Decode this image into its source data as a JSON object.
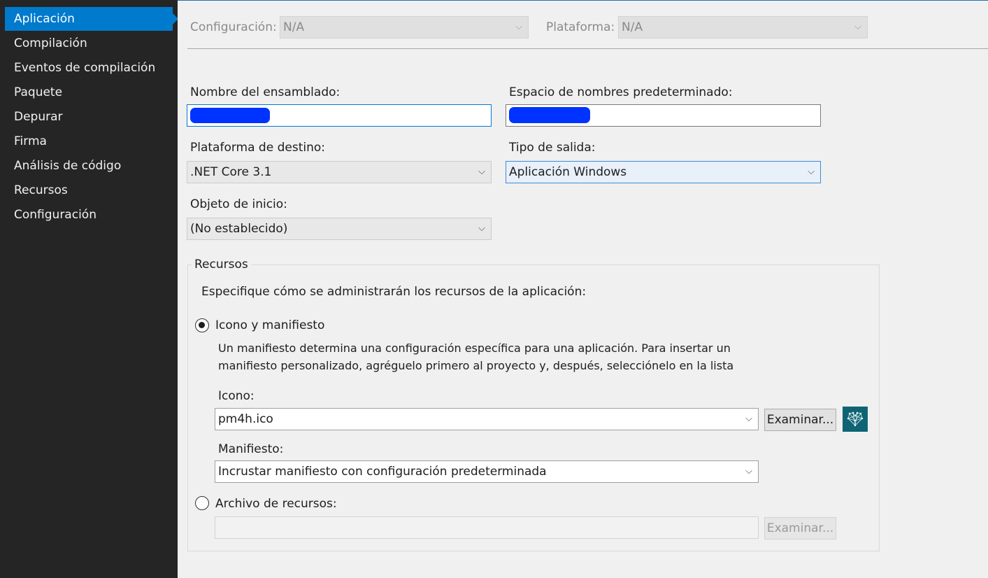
{
  "sidebar": {
    "items": [
      {
        "label": "Aplicación",
        "active": true
      },
      {
        "label": "Compilación"
      },
      {
        "label": "Eventos de compilación"
      },
      {
        "label": "Paquete"
      },
      {
        "label": "Depurar"
      },
      {
        "label": "Firma"
      },
      {
        "label": "Análisis de código"
      },
      {
        "label": "Recursos"
      },
      {
        "label": "Configuración"
      }
    ]
  },
  "toolbar": {
    "configuration_label": "Configuración:",
    "configuration_value": "N/A",
    "platform_label": "Plataforma:",
    "platform_value": "N/A"
  },
  "form": {
    "assembly_name_label": "Nombre del ensamblado:",
    "default_namespace_label": "Espacio de nombres predeterminado:",
    "target_framework_label": "Plataforma de destino:",
    "target_framework_value": ".NET Core 3.1",
    "output_type_label": "Tipo de salida:",
    "output_type_value": "Aplicación Windows",
    "startup_object_label": "Objeto de inicio:",
    "startup_object_value": "(No establecido)"
  },
  "resources": {
    "title": "Recursos",
    "description": "Especifique cómo se administrarán los recursos de la aplicación:",
    "icon_manifest_option": "Icono y manifiesto",
    "icon_manifest_selected": true,
    "manifest_help_line1": "Un manifiesto determina una configuración específica para una aplicación. Para insertar un",
    "manifest_help_line2": "manifiesto personalizado, agréguelo primero al proyecto y, después, selecciónelo en la lista",
    "icon_label": "Icono:",
    "icon_value": "pm4h.ico",
    "browse_label": "Examinar...",
    "manifest_label": "Manifiesto:",
    "manifest_value": "Incrustar manifiesto con configuración predeterminada",
    "resource_file_option": "Archivo de recursos:",
    "resource_file_selected": false,
    "resource_browse_label": "Examinar..."
  },
  "colors": {
    "accent": "#007acc",
    "sidebar_bg": "#252526",
    "redaction": "#0033ff"
  }
}
